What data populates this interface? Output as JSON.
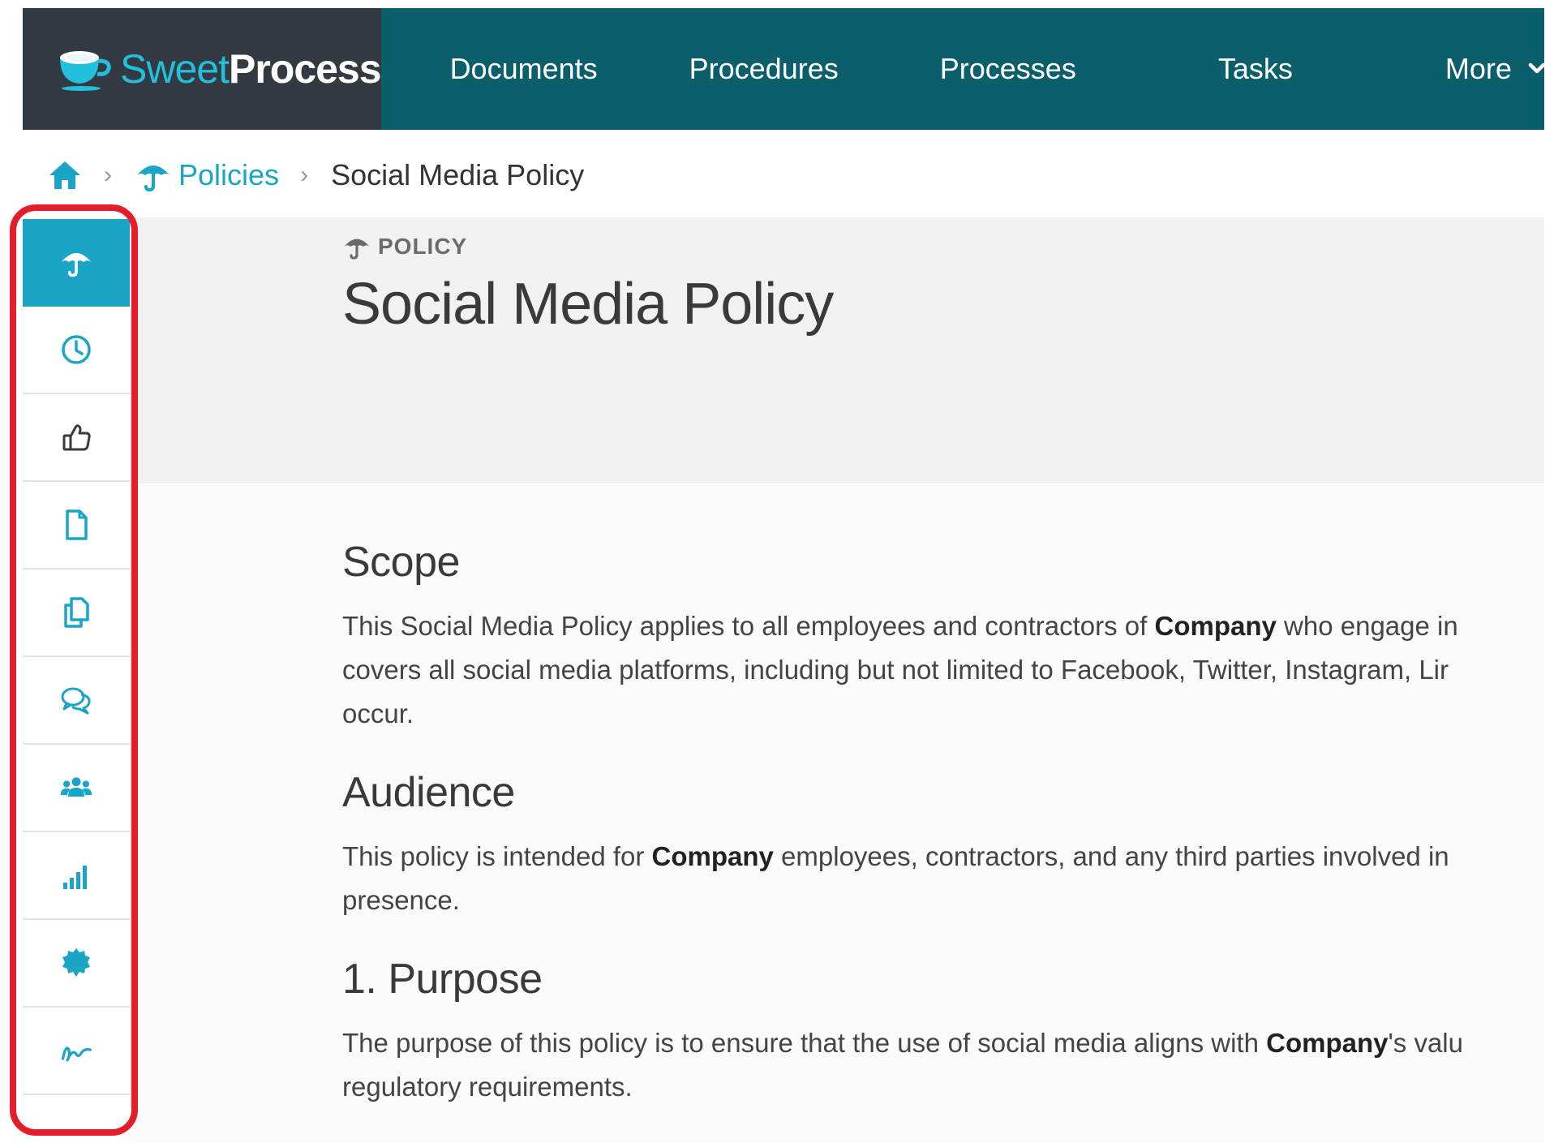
{
  "brand": {
    "name_part1": "Sweet",
    "name_part2": "Process"
  },
  "nav": {
    "items": [
      "Documents",
      "Procedures",
      "Processes",
      "Tasks",
      "More"
    ]
  },
  "breadcrumb": {
    "parent": "Policies",
    "current": "Social Media Policy"
  },
  "page": {
    "type_label": "POLICY",
    "title": "Social Media Policy"
  },
  "document": {
    "scope": {
      "heading": "Scope",
      "p1_a": "This Social Media Policy applies to all employees and contractors of ",
      "p1_b": "Company",
      "p1_c": " who engage in",
      "p2": "covers all social media platforms, including but not limited to Facebook, Twitter, Instagram, Lir",
      "p3": "occur."
    },
    "audience": {
      "heading": "Audience",
      "p1_a": "This policy is intended for ",
      "p1_b": "Company",
      "p1_c": " employees, contractors, and any third parties involved in",
      "p2": "presence."
    },
    "purpose": {
      "heading": "1. Purpose",
      "p1_a": "The purpose of this policy is to ensure that the use of social media aligns with ",
      "p1_b": "Company",
      "p1_c": "'s valu",
      "p2": "regulatory requirements."
    }
  },
  "sidebar": {
    "icons": [
      "policy-umbrella-icon",
      "clock-icon",
      "thumbs-up-icon",
      "document-icon",
      "copy-icon",
      "comments-icon",
      "users-icon",
      "signal-bars-icon",
      "badge-icon",
      "signature-icon"
    ],
    "active_index": 0
  },
  "colors": {
    "nav_bg": "#0a5f6b",
    "logo_bg": "#333a41",
    "accent": "#1aa5c7",
    "highlight": "#e31d2a"
  }
}
